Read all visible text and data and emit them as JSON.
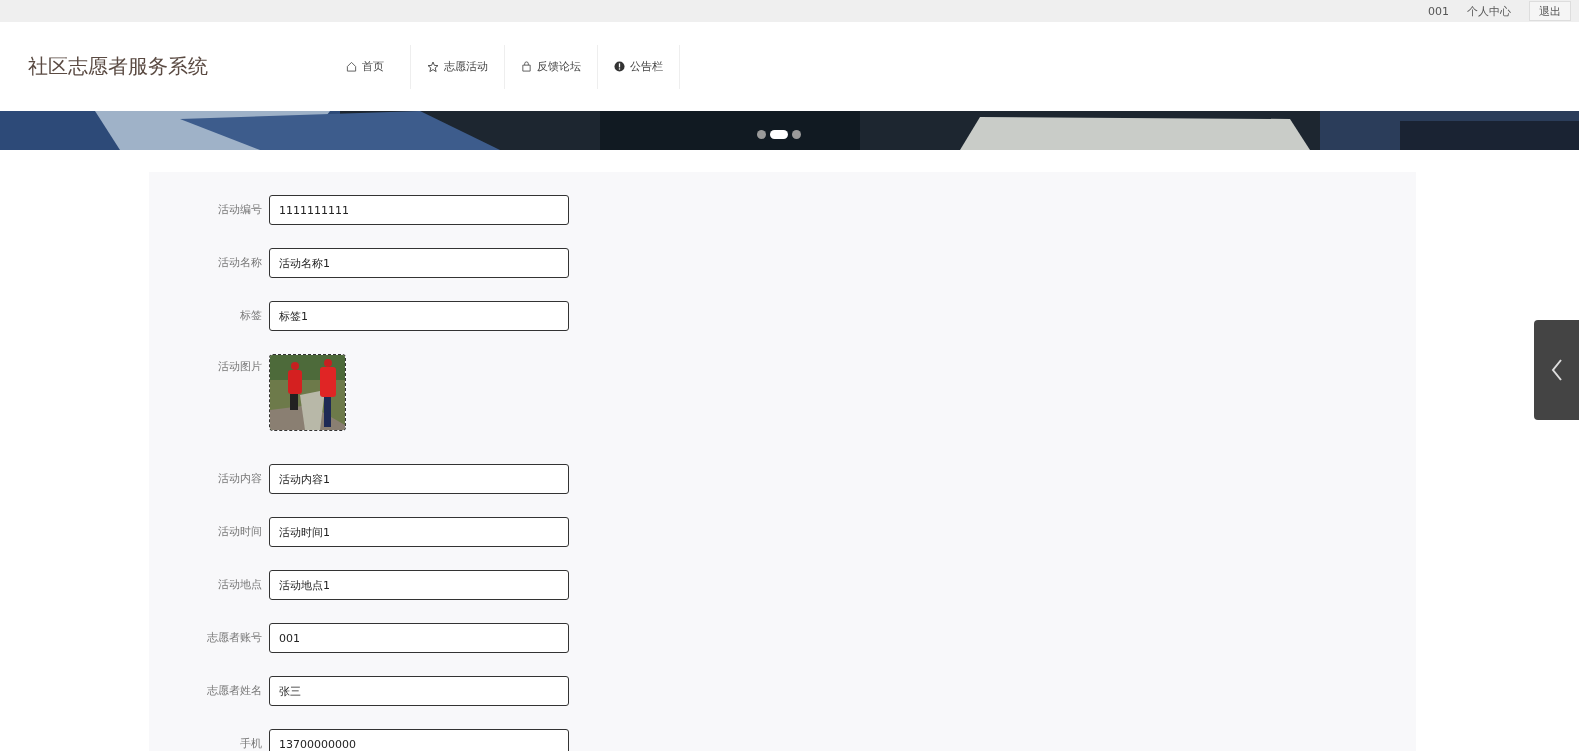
{
  "top_bar": {
    "user": "001",
    "links": [
      "个人中心"
    ],
    "logout_button": "退出"
  },
  "header": {
    "site_title": "社区志愿者服务系统",
    "nav": [
      {
        "label": "首页"
      },
      {
        "label": "志愿活动"
      },
      {
        "label": "反馈论坛"
      },
      {
        "label": "公告栏"
      }
    ]
  },
  "banner": {
    "kind": "picture",
    "dots": [
      {
        "selected": false
      },
      {
        "selected": true
      },
      {
        "selected": false
      }
    ]
  },
  "form": {
    "fields": [
      {
        "kind": "text",
        "label": "活动编号",
        "value": "1111111111"
      },
      {
        "kind": "text",
        "label": "活动名称",
        "value": "活动名称1"
      },
      {
        "kind": "text",
        "label": "标签",
        "value": "标签1"
      },
      {
        "label": "活动图片"
      },
      {
        "kind": "text",
        "label": "活动内容",
        "value": "活动内容1"
      },
      {
        "kind": "text",
        "label": "活动时间",
        "value": "活动时间1"
      },
      {
        "kind": "text",
        "label": "活动地点",
        "value": "活动地点1"
      },
      {
        "kind": "text",
        "label": "志愿者账号",
        "value": "001"
      },
      {
        "kind": "text",
        "label": "志愿者姓名",
        "value": "张三"
      },
      {
        "kind": "text",
        "label": "手机",
        "value": "13700000000"
      }
    ]
  }
}
